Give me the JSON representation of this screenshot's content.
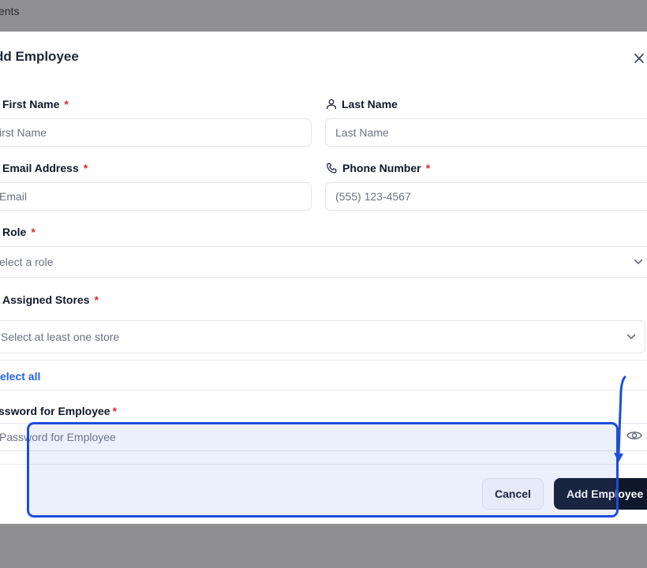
{
  "background": {
    "page_text": "ents"
  },
  "modal": {
    "title": "dd Employee",
    "fields": {
      "first_name": {
        "label": "First Name",
        "required": "*",
        "placeholder": "irst Name"
      },
      "last_name": {
        "label": "Last Name",
        "placeholder": "Last Name"
      },
      "email": {
        "label": "Email Address",
        "required": "*",
        "placeholder": "Email"
      },
      "phone": {
        "label": "Phone Number",
        "required": "*",
        "placeholder": "(555) 123-4567"
      },
      "role": {
        "label": "Role",
        "required": "*",
        "placeholder": "elect a role"
      },
      "stores": {
        "label": "Assigned Stores",
        "required": "*",
        "placeholder": "Select at least one store",
        "select_all": "elect all"
      },
      "password": {
        "label": "ssword for Employee",
        "required": "*",
        "placeholder": "Password for Employee"
      }
    },
    "buttons": {
      "cancel": "Cancel",
      "add": "Add Employee"
    }
  },
  "icons": {
    "close": "close-icon",
    "user": "user-icon",
    "phone": "phone-icon",
    "chevron": "chevron-down-icon",
    "eye": "eye-icon"
  },
  "colors": {
    "accent": "#2563eb",
    "primary_button": "#0f172a",
    "required": "#dc2626",
    "highlight": "#1d4ed8"
  }
}
